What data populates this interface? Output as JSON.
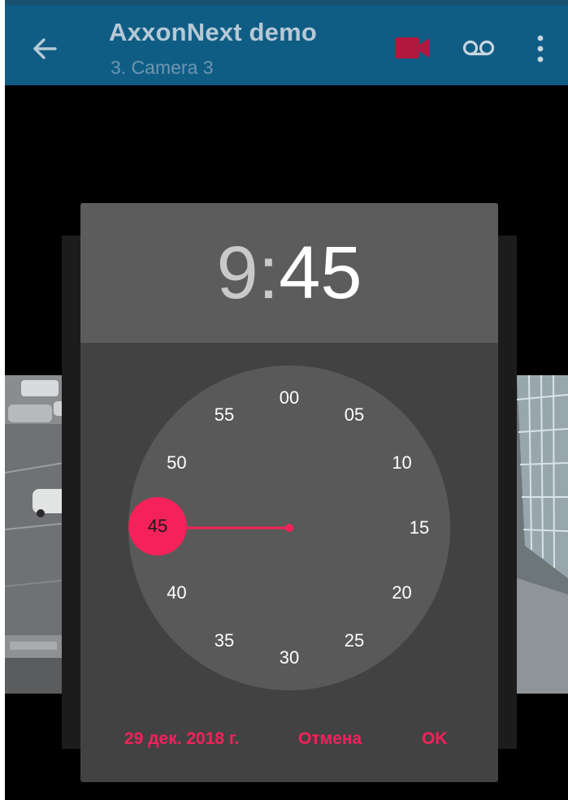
{
  "app": {
    "title": "AxxonNext demo",
    "subtitle": "3. Camera 3",
    "icons": [
      "back-arrow-icon",
      "video-camera-icon",
      "voicemail-icon",
      "more-vertical-icon"
    ],
    "colors": {
      "appbar": "#0f5d85",
      "accent": "#f5215a",
      "camera_icon": "#b3183e"
    }
  },
  "time_picker": {
    "hour": "9",
    "separator": ":",
    "minute": "45",
    "minute_labels": [
      "00",
      "05",
      "10",
      "15",
      "20",
      "25",
      "30",
      "35",
      "40",
      "45",
      "50",
      "55"
    ],
    "selected_minute": "45"
  },
  "actions": {
    "date": "29 дек. 2018 г.",
    "cancel": "Отмена",
    "ok": "OK"
  }
}
